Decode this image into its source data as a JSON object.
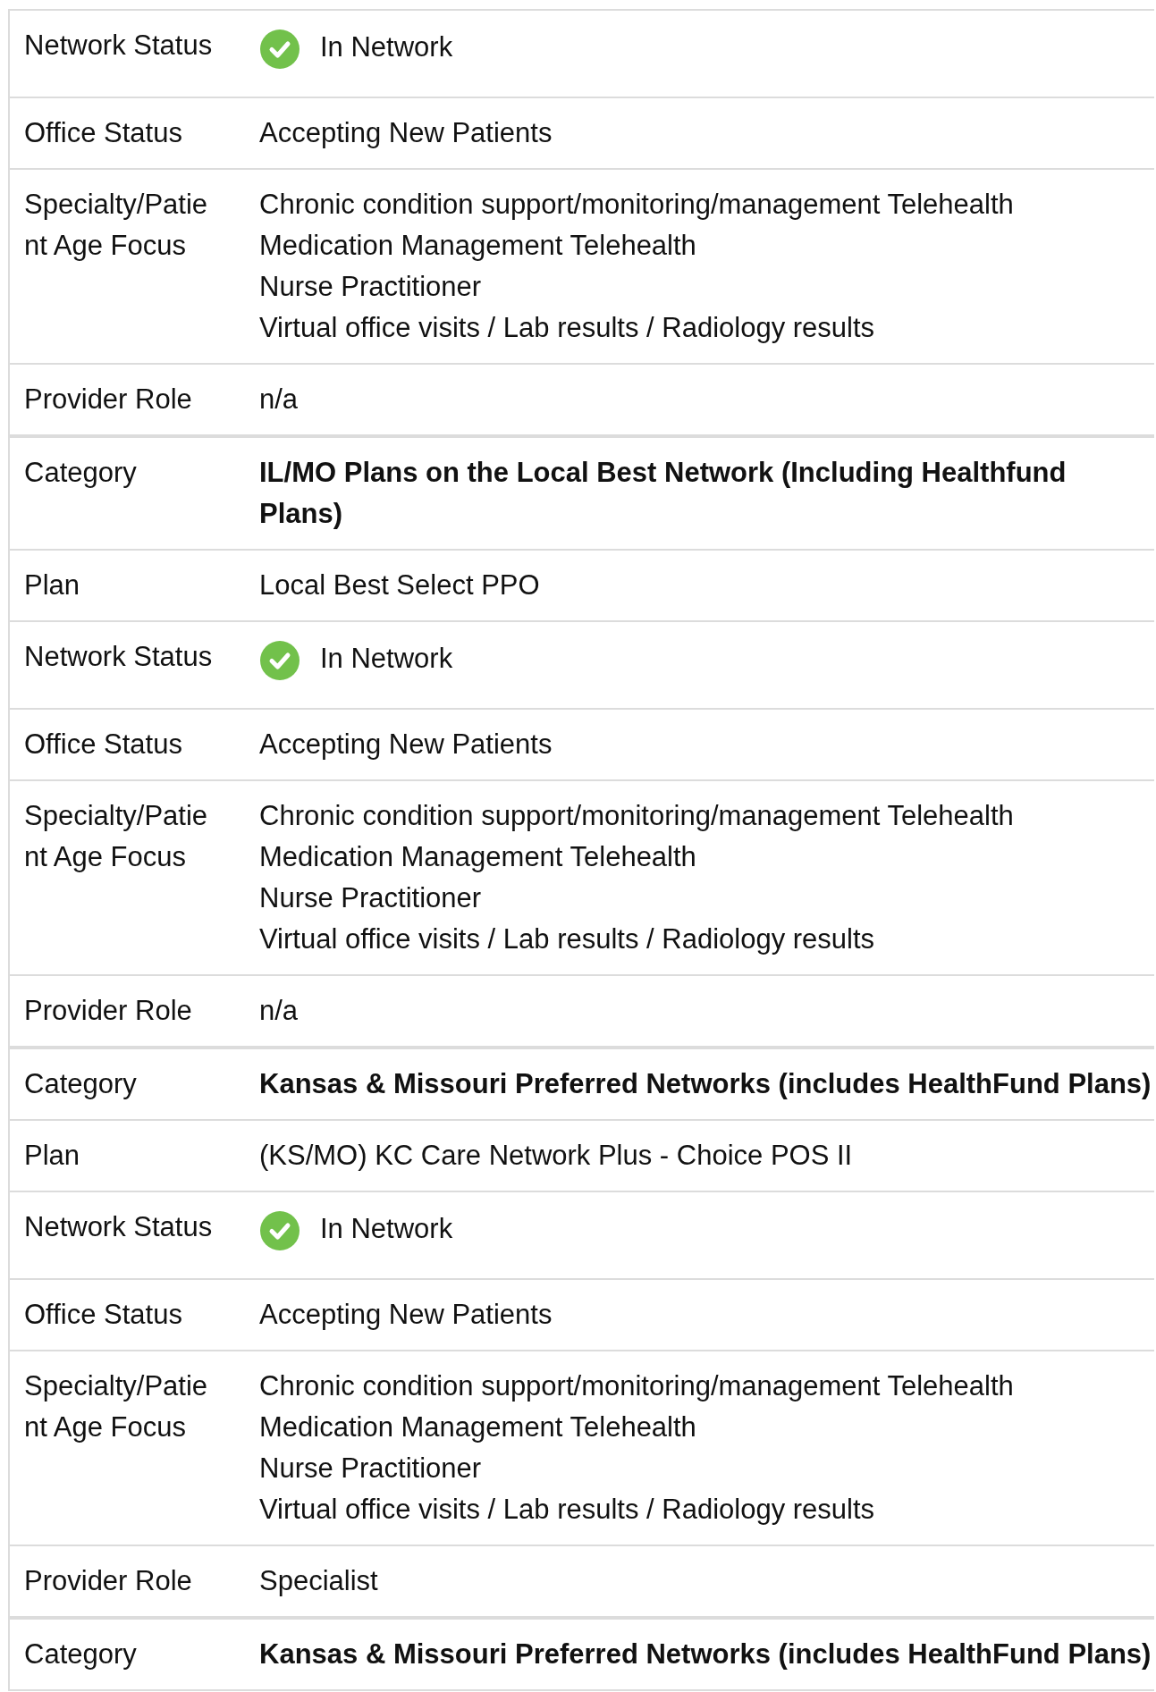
{
  "groups": [
    {
      "rows": [
        {
          "kind": "network",
          "label": "Network Status",
          "value": "In Network"
        },
        {
          "kind": "text",
          "label": "Office Status",
          "value": "Accepting New Patients"
        },
        {
          "kind": "lines",
          "label": "Specialty/Patient Age Focus",
          "lines": [
            "Chronic condition support/monitoring/management Telehealth",
            "Medication Management Telehealth",
            "Nurse Practitioner",
            "Virtual office visits / Lab results / Radiology results"
          ]
        },
        {
          "kind": "text",
          "label": "Provider Role",
          "value": "n/a"
        }
      ]
    },
    {
      "rows": [
        {
          "kind": "category",
          "label": "Category",
          "value": "IL/MO Plans on the Local Best Network (Including Healthfund Plans)"
        },
        {
          "kind": "text",
          "label": "Plan",
          "value": "Local Best Select PPO"
        },
        {
          "kind": "network",
          "label": "Network Status",
          "value": "In Network"
        },
        {
          "kind": "text",
          "label": "Office Status",
          "value": "Accepting New Patients"
        },
        {
          "kind": "lines",
          "label": "Specialty/Patient Age Focus",
          "lines": [
            "Chronic condition support/monitoring/management Telehealth",
            "Medication Management Telehealth",
            "Nurse Practitioner",
            "Virtual office visits / Lab results / Radiology results"
          ]
        },
        {
          "kind": "text",
          "label": "Provider Role",
          "value": "n/a"
        }
      ]
    },
    {
      "rows": [
        {
          "kind": "category",
          "label": "Category",
          "value": "Kansas & Missouri Preferred Networks (includes HealthFund Plans)"
        },
        {
          "kind": "text",
          "label": "Plan",
          "value": "(KS/MO) KC Care Network Plus - Choice POS II"
        },
        {
          "kind": "network",
          "label": "Network Status",
          "value": "In Network"
        },
        {
          "kind": "text",
          "label": "Office Status",
          "value": "Accepting New Patients"
        },
        {
          "kind": "lines",
          "label": "Specialty/Patient Age Focus",
          "lines": [
            "Chronic condition support/monitoring/management Telehealth",
            "Medication Management Telehealth",
            "Nurse Practitioner",
            "Virtual office visits / Lab results / Radiology results"
          ]
        },
        {
          "kind": "text",
          "label": "Provider Role",
          "value": "Specialist"
        }
      ]
    },
    {
      "rows": [
        {
          "kind": "category",
          "label": "Category",
          "value": "Kansas & Missouri Preferred Networks (includes HealthFund Plans)"
        }
      ]
    }
  ]
}
